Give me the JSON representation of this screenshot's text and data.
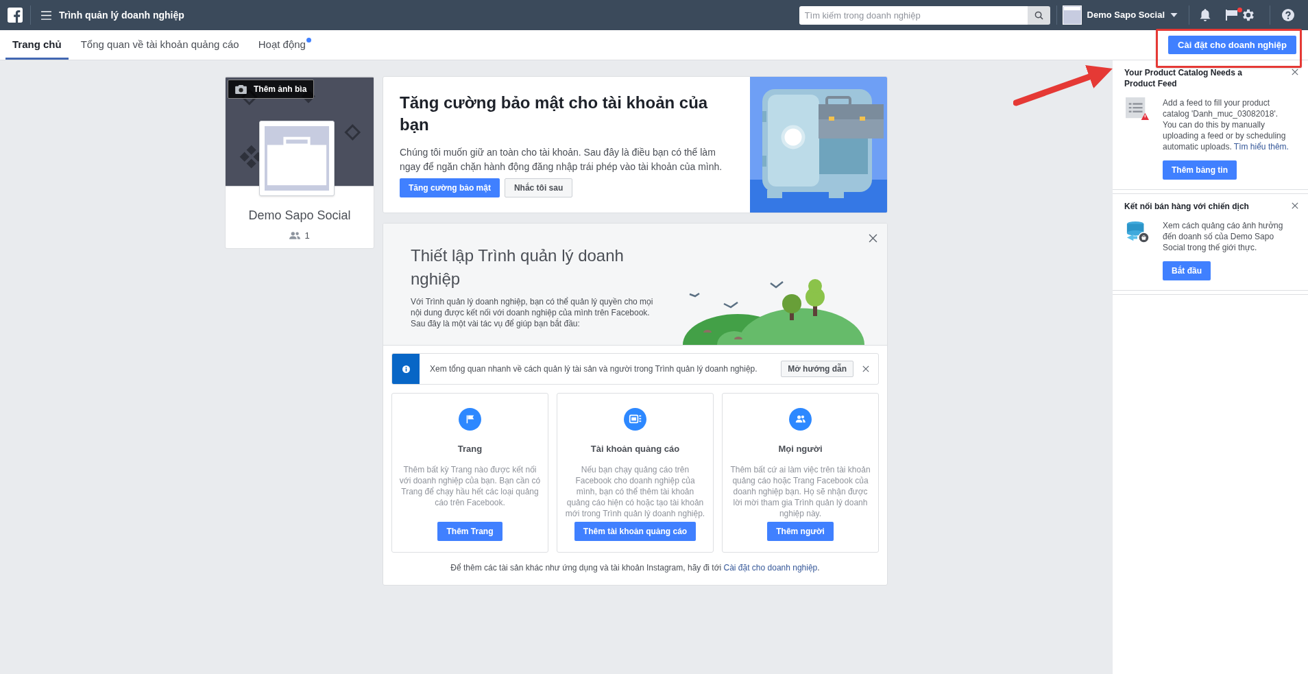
{
  "top_bar": {
    "title": "Trình quản lý doanh nghiệp",
    "search": {
      "placeholder": "Tìm kiếm trong doanh nghiệp"
    },
    "account": "Demo Sapo Social",
    "flag_badge": true
  },
  "tabs": [
    {
      "label": "Trang chủ",
      "selected": true,
      "dot": false
    },
    {
      "label": "Tổng quan về tài khoản quảng cáo",
      "selected": false,
      "dot": false
    },
    {
      "label": "Hoạt động",
      "selected": false,
      "dot": true
    }
  ],
  "settings_button": "Cài đặt cho doanh nghiệp",
  "profile": {
    "cover_button": "Thêm ảnh bìa",
    "name": "Demo Sapo Social",
    "people_count": "1"
  },
  "security_card": {
    "title": "Tăng cường bảo mật cho tài khoản của bạn",
    "text": "Chúng tôi muốn giữ an toàn cho tài khoản. Sau đây là điều bạn có thể làm ngay để ngăn chặn hành động đăng nhập trái phép vào tài khoản của mình.",
    "primary_button": "Tăng cường bảo mật",
    "secondary_button": "Nhắc tôi sau"
  },
  "setup_card": {
    "title": "Thiết lập Trình quản lý doanh nghiệp",
    "text": "Với Trình quản lý doanh nghiệp, bạn có thể quản lý quyền cho mọi nội dung được kết nối với doanh nghiệp của mình trên Facebook. Sau đây là một vài tác vụ để giúp bạn bắt đầu:",
    "info_bar": {
      "text": "Xem tổng quan nhanh về cách quản lý tài sản và người trong Trình quản lý doanh nghiệp.",
      "button": "Mở hướng dẫn"
    },
    "tasks": [
      {
        "kind": "page",
        "title": "Trang",
        "text": "Thêm bất kỳ Trang nào được kết nối với doanh nghiệp của bạn. Bạn cần có Trang để chạy hầu hết các loại quảng cáo trên Facebook.",
        "button": "Thêm Trang"
      },
      {
        "kind": "ad_account",
        "title": "Tài khoản quảng cáo",
        "text": "Nếu bạn chạy quảng cáo trên Facebook cho doanh nghiệp của mình, bạn có thể thêm tài khoản quảng cáo hiện có hoặc tạo tài khoản mới trong Trình quản lý doanh nghiệp.",
        "button": "Thêm tài khoản quảng cáo"
      },
      {
        "kind": "people",
        "title": "Mọi người",
        "text": "Thêm bất cứ ai làm việc trên tài khoản quảng cáo hoặc Trang Facebook của doanh nghiệp bạn. Họ sẽ nhận được lời mời tham gia Trình quản lý doanh nghiệp này.",
        "button": "Thêm người"
      }
    ],
    "footer": {
      "text": "Để thêm các tài sản khác như ứng dụng và tài khoản Instagram, hãy đi tới ",
      "link": "Cài đặt cho doanh nghiệp",
      "suffix": "."
    }
  },
  "notifications": [
    {
      "kind": "catalog",
      "title": "Your Product Catalog Needs a Product Feed",
      "text": "Add a feed to fill your product catalog 'Danh_muc_03082018'. You can do this by manually uploading a feed or by scheduling automatic uploads. ",
      "link": "Tìm hiểu thêm.",
      "button": "Thêm bảng tin"
    },
    {
      "kind": "sales",
      "title": "Kết nối bán hàng với chiến dịch",
      "text": "Xem cách quảng cáo ảnh hưởng đến doanh số của Demo Sapo Social trong thế giới thực.",
      "button": "Bắt đầu"
    }
  ]
}
